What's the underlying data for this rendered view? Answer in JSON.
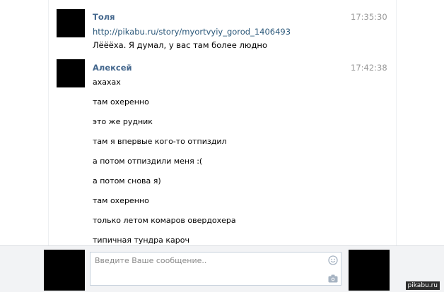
{
  "messages": [
    {
      "author": "Толя",
      "time": "17:35:30",
      "link_text": "http://pikabu.ru/story/myortvyiy_gorod_1406493",
      "text_after_link": " Лёёёха. Я думал, у вас там более людно"
    },
    {
      "author": "Алексей",
      "time": "17:42:38",
      "lines": [
        "ахахах",
        "там охеренно",
        "это же рудник",
        "там я впервые кого-то отпиздил",
        "а потом отпиздили меня :(",
        "а потом снова я)",
        "там охеренно",
        "только летом комаров овердохера",
        "типичная тундра кароч"
      ]
    }
  ],
  "composer": {
    "placeholder": "Введите Ваше сообщение..",
    "value": ""
  },
  "icons": {
    "emoji": "smiley-icon",
    "attach_photo": "camera-icon"
  },
  "watermark": "pikabu.ru",
  "colors": {
    "author": "#45688e",
    "link": "#2b587a",
    "time": "#999999",
    "bottom_bar": "#f2f3f5",
    "input_border": "#c5d0db"
  }
}
